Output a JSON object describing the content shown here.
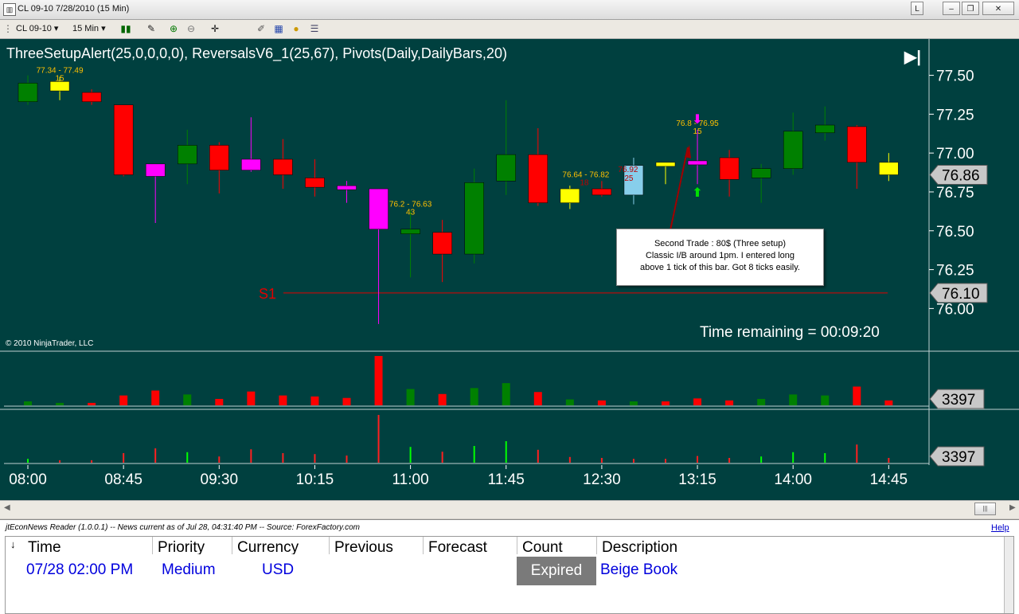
{
  "window": {
    "title": "CL 09-10  7/28/2010 (15 Min)",
    "minimize": "–",
    "restore": "❐",
    "close": "✕",
    "lock": "L"
  },
  "toolbar": {
    "instrument": "CL 09-10",
    "interval": "15 Min"
  },
  "chart": {
    "indicator_title": "ThreeSetupAlert(25,0,0,0,0), ReversalsV6_1(25,67), Pivots(Daily,DailyBars,20)",
    "copyright": "© 2010 NinjaTrader, LLC",
    "time_remaining": "Time remaining = 00:09:20",
    "pivot_label": "S1",
    "pivot_value": "76.10",
    "last_price": "76.86",
    "volume_last": "3397",
    "indicator_last": "3397",
    "price_ticks": [
      "77.50",
      "77.25",
      "77.00",
      "76.75",
      "76.50",
      "76.25",
      "76.00"
    ],
    "time_ticks": [
      "08:00",
      "08:45",
      "09:30",
      "10:15",
      "11:00",
      "11:45",
      "12:30",
      "13:15",
      "14:00",
      "14:45"
    ],
    "colors": {
      "background": "#00403f",
      "up": "#008000",
      "down": "#ff0000",
      "magenta": "#ff00ff",
      "yellow": "#ffff00",
      "lightblue": "#87ceeb",
      "annotation_text": "#ffc000"
    },
    "annotation": {
      "line1": "Second Trade : 80$ (Three setup)",
      "line2": "Classic I/B around 1pm. I entered long",
      "line3": "above 1 tick of this bar. Got 8 ticks easily."
    },
    "bar_labels": [
      {
        "range": "77.34 - 77.49",
        "count": "15"
      },
      {
        "range": "76.2 - 76.63",
        "count": "43"
      },
      {
        "range": "76.64 - 76.82",
        "count": "18"
      },
      {
        "range": "76.92",
        "count": "25"
      },
      {
        "range": "76.8 - 76.95",
        "count": "15"
      }
    ]
  },
  "chart_data": {
    "type": "candlestick",
    "symbol": "CL 09-10",
    "interval": "15 Min",
    "date": "7/28/2010",
    "ylim": [
      75.92,
      77.59
    ],
    "bars": [
      {
        "time": "08:00",
        "open": 77.33,
        "high": 77.5,
        "low": 77.31,
        "close": 77.45,
        "color": "green",
        "volume": 0.08
      },
      {
        "time": "08:15",
        "open": 77.4,
        "high": 77.49,
        "low": 77.34,
        "close": 77.46,
        "color": "yellow",
        "volume": 0.05
      },
      {
        "time": "08:30",
        "open": 77.39,
        "high": 77.41,
        "low": 77.31,
        "close": 77.33,
        "color": "red",
        "volume": 0.05
      },
      {
        "time": "08:45",
        "open": 77.31,
        "high": 77.31,
        "low": 76.85,
        "close": 76.86,
        "color": "red",
        "volume": 0.2
      },
      {
        "time": "09:00",
        "open": 76.93,
        "high": 76.93,
        "low": 76.55,
        "close": 76.85,
        "color": "magenta",
        "volume": 0.3
      },
      {
        "time": "09:15",
        "open": 76.93,
        "high": 77.15,
        "low": 76.8,
        "close": 77.05,
        "color": "green",
        "volume": 0.22
      },
      {
        "time": "09:30",
        "open": 77.05,
        "high": 77.07,
        "low": 76.74,
        "close": 76.89,
        "color": "red",
        "volume": 0.13
      },
      {
        "time": "09:45",
        "open": 76.96,
        "high": 77.23,
        "low": 76.88,
        "close": 76.89,
        "color": "magenta",
        "volume": 0.28
      },
      {
        "time": "10:00",
        "open": 76.96,
        "high": 77.09,
        "low": 76.77,
        "close": 76.86,
        "color": "red",
        "volume": 0.2
      },
      {
        "time": "10:15",
        "open": 76.84,
        "high": 76.96,
        "low": 76.72,
        "close": 76.78,
        "color": "red",
        "volume": 0.18
      },
      {
        "time": "10:30",
        "open": 76.79,
        "high": 76.82,
        "low": 76.68,
        "close": 76.77,
        "color": "magenta",
        "volume": 0.15
      },
      {
        "time": "10:45",
        "open": 76.77,
        "high": 76.77,
        "low": 75.9,
        "close": 76.51,
        "color": "magenta",
        "volume": 1.0
      },
      {
        "time": "11:00",
        "open": 76.51,
        "high": 76.63,
        "low": 76.2,
        "close": 76.48,
        "color": "green",
        "volume": 0.33
      },
      {
        "time": "11:15",
        "open": 76.49,
        "high": 76.57,
        "low": 76.17,
        "close": 76.35,
        "color": "red",
        "volume": 0.23
      },
      {
        "time": "11:30",
        "open": 76.35,
        "high": 76.9,
        "low": 76.29,
        "close": 76.81,
        "color": "green",
        "volume": 0.35
      },
      {
        "time": "11:45",
        "open": 76.82,
        "high": 77.34,
        "low": 76.73,
        "close": 76.99,
        "color": "green",
        "volume": 0.45
      },
      {
        "time": "12:00",
        "open": 76.99,
        "high": 77.16,
        "low": 76.66,
        "close": 76.68,
        "color": "red",
        "volume": 0.27
      },
      {
        "time": "12:15",
        "open": 76.68,
        "high": 76.79,
        "low": 76.64,
        "close": 76.77,
        "color": "yellow",
        "volume": 0.12
      },
      {
        "time": "12:30",
        "open": 76.77,
        "high": 76.82,
        "low": 76.72,
        "close": 76.73,
        "color": "red",
        "volume": 0.1
      },
      {
        "time": "12:45",
        "open": 76.73,
        "high": 76.97,
        "low": 76.67,
        "close": 76.92,
        "color": "lightblue",
        "volume": 0.08
      },
      {
        "time": "13:00",
        "open": 76.94,
        "high": 76.94,
        "low": 76.8,
        "close": 76.94,
        "color": "yellow",
        "volume": 0.08
      },
      {
        "time": "13:15",
        "open": 76.95,
        "high": 77.15,
        "low": 76.8,
        "close": 76.95,
        "color": "magenta",
        "volume": 0.14
      },
      {
        "time": "13:30",
        "open": 76.97,
        "high": 77.02,
        "low": 76.72,
        "close": 76.83,
        "color": "red",
        "volume": 0.1
      },
      {
        "time": "13:45",
        "open": 76.84,
        "high": 76.93,
        "low": 76.68,
        "close": 76.9,
        "color": "green",
        "volume": 0.13
      },
      {
        "time": "14:00",
        "open": 76.9,
        "high": 77.26,
        "low": 76.86,
        "close": 77.14,
        "color": "green",
        "volume": 0.22
      },
      {
        "time": "14:15",
        "open": 77.13,
        "high": 77.3,
        "low": 77.08,
        "close": 77.18,
        "color": "green",
        "volume": 0.2
      },
      {
        "time": "14:30",
        "open": 77.17,
        "high": 77.18,
        "low": 76.77,
        "close": 76.94,
        "color": "red",
        "volume": 0.38
      },
      {
        "time": "14:45",
        "open": 76.94,
        "high": 77.0,
        "low": 76.82,
        "close": 76.86,
        "color": "yellow",
        "volume": 0.1
      }
    ],
    "pivot_s1": 76.1,
    "indicator_bars": [
      0.08,
      0.05,
      0.05,
      0.2,
      0.3,
      0.22,
      0.13,
      0.28,
      0.2,
      0.18,
      0.15,
      1.0,
      0.33,
      0.23,
      0.35,
      0.45,
      0.27,
      0.12,
      0.1,
      0.08,
      0.08,
      0.14,
      0.1,
      0.13,
      0.22,
      0.2,
      0.38,
      0.1
    ]
  },
  "news": {
    "header": "jtEconNews Reader (1.0.0.1)  --  News current as of Jul 28, 04:31:40 PM  --  Source: ForexFactory.com",
    "help": "Help",
    "columns": [
      "Time",
      "Priority",
      "Currency",
      "Previous",
      "Forecast",
      "Count",
      "Description"
    ],
    "row": {
      "time": "07/28 02:00 PM",
      "priority": "Medium",
      "currency": "USD",
      "count": "Expired",
      "description": "Beige Book"
    }
  }
}
